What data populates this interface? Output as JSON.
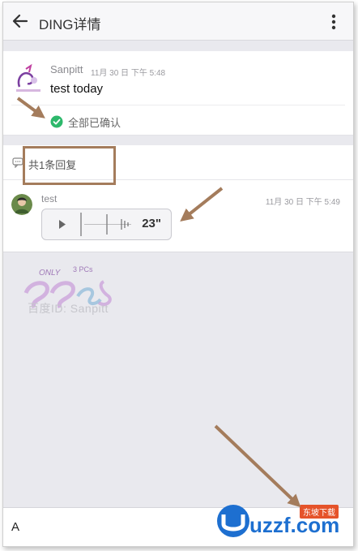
{
  "header": {
    "title": "DING详情",
    "back_icon": "arrow-left-icon",
    "menu_icon": "more-vertical-icon"
  },
  "message": {
    "sender": "Sanpitt",
    "time": "11月 30 日 下午 5:48",
    "text": "test today",
    "ack_label": "全部已确认",
    "ack_icon": "check-circle-icon",
    "ack_color": "#2db86b"
  },
  "replies": {
    "count_label": "共1条回复",
    "items": [
      {
        "user": "test",
        "time": "11月 30 日 下午 5:49",
        "voice_duration": "23\""
      }
    ]
  },
  "watermark": {
    "text": "百度ID: Sanpitt"
  },
  "input": {
    "value": "A"
  },
  "site_badge": {
    "logo_text": "uzzf.com",
    "tag": "东坡下载"
  },
  "colors": {
    "annotation": "#a47c5c",
    "accent": "#2db86b"
  }
}
